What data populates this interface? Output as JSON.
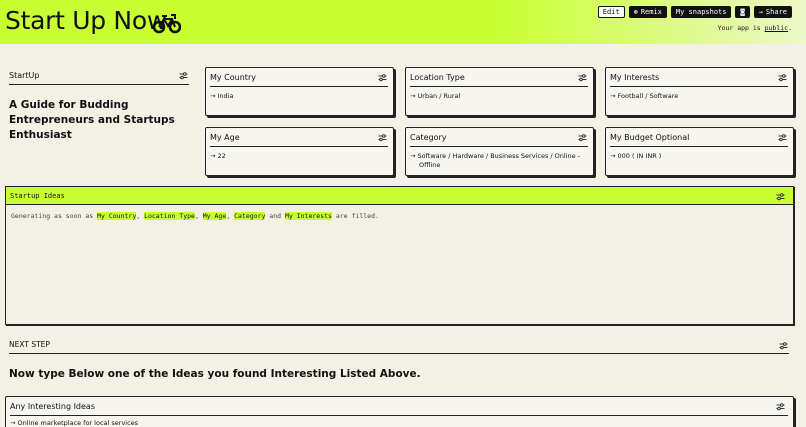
{
  "header": {
    "title": "Start Up Now",
    "icon": "motorcycle-icon",
    "buttons": {
      "edit": "Edit",
      "remix": "Remix",
      "snapshots": "My snapshots",
      "share": "Share"
    },
    "public_prefix": "Your app is ",
    "public_link": "public",
    "public_suffix": "."
  },
  "intro": {
    "label": "StartUp",
    "heading": "A Guide for Budding Entrepreneurs and Startups Enthusiast"
  },
  "fields": {
    "country": {
      "title": "My Country",
      "value": "→ India"
    },
    "location": {
      "title": "Location Type",
      "value": "→ Urban / Rural"
    },
    "interests": {
      "title": "My Interests",
      "value": "→ Football / Software"
    },
    "age": {
      "title": "My Age",
      "value": "→ 22"
    },
    "category": {
      "title": "Category",
      "value": "→ Software / Hardware / Business Services / Online -",
      "value2": "Offline"
    },
    "budget": {
      "title": "My Budget Optional",
      "value": "→ 000 ( IN INR )"
    }
  },
  "ideas": {
    "title": "Startup Ideas",
    "text_start": "Generating as soon as ",
    "hl1": "My Country",
    "sep1": ", ",
    "hl2": "Location Type",
    "sep2": ", ",
    "hl3": "My Age",
    "sep3": ", ",
    "hl4": "Category",
    "sep4": " and ",
    "hl5": "My Interests",
    "text_end": " are filled."
  },
  "next": {
    "label": "NEXT STEP",
    "heading": "Now type Below one of the Ideas you found Interesting Listed Above."
  },
  "interesting": {
    "title": "Any Interesting Ideas",
    "value": "→ Online marketplace for local services"
  },
  "colors": {
    "accent": "#c8ff33",
    "background": "#f3f0e6",
    "ink": "#111111"
  }
}
